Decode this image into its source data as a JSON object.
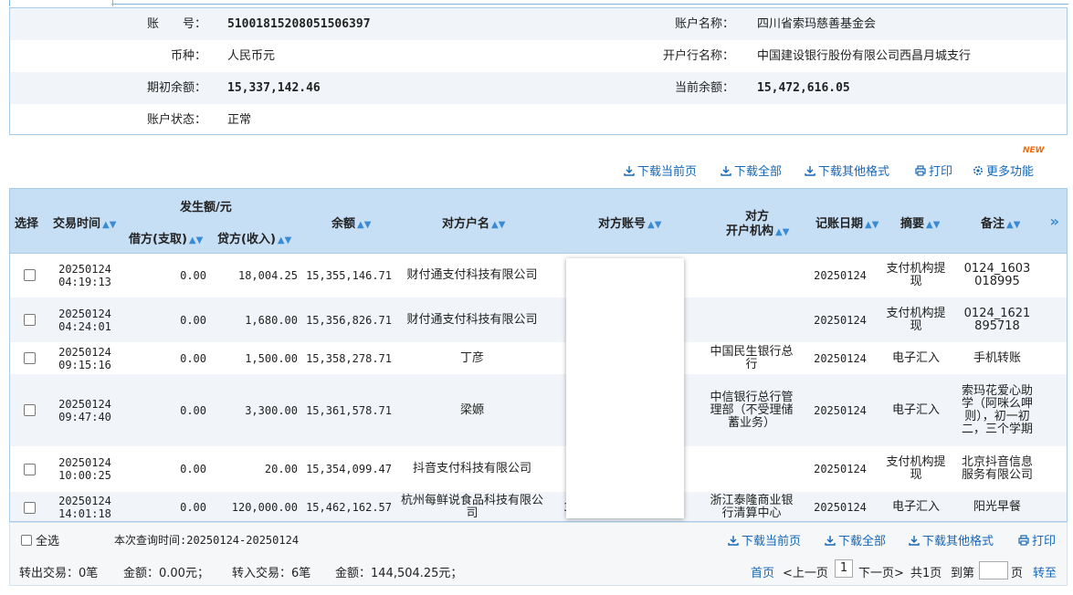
{
  "account_info": {
    "account_no_label": "账　　号：",
    "account_no": "51001815208051506397",
    "account_name_label": "账户名称：",
    "account_name": "四川省索玛慈善基金会",
    "currency_label": "币种：",
    "currency": "人民币元",
    "bank_label": "开户行名称：",
    "bank": "中国建设银行股份有限公司西昌月城支行",
    "opening_balance_label": "期初余额：",
    "opening_balance": "15,337,142.46",
    "current_balance_label": "当前余额：",
    "current_balance": "15,472,616.05",
    "status_label": "账户状态：",
    "status": "正常"
  },
  "toolbar": {
    "download_page": "下载当前页",
    "download_all": "下载全部",
    "download_other": "下载其他格式",
    "print": "打印",
    "more": "更多功能",
    "new_badge": "NEW"
  },
  "table": {
    "headers": {
      "select": "选择",
      "time": "交易时间",
      "amount_group": "发生额/元",
      "debit": "借方(支取)",
      "credit": "贷方(收入)",
      "balance": "余额",
      "counterparty_name": "对方户名",
      "counterparty_account": "对方账号",
      "counterparty_bank_1": "对方",
      "counterparty_bank_2": "开户机构",
      "post_date": "记账日期",
      "summary": "摘要",
      "remark": "备注",
      "more": "»"
    },
    "rows": [
      {
        "date": "20250124",
        "time": "04:19:13",
        "debit": "0.00",
        "credit": "18,004.25",
        "balance": "15,355,146.71",
        "name": "财付通支付科技有限公司",
        "bank": "",
        "post": "20250124",
        "summary": "支付机构提现",
        "remark": "0124_1603018995"
      },
      {
        "date": "20250124",
        "time": "04:24:01",
        "debit": "0.00",
        "credit": "1,680.00",
        "balance": "15,356,826.71",
        "name": "财付通支付科技有限公司",
        "bank": "",
        "post": "20250124",
        "summary": "支付机构提现",
        "remark": "0124_1621895718"
      },
      {
        "date": "20250124",
        "time": "09:15:16",
        "debit": "0.00",
        "credit": "1,500.00",
        "balance": "15,358,278.71",
        "name": "丁彦",
        "bank": "中国民生银行总行",
        "post": "20250124",
        "summary": "电子汇入",
        "remark": "手机转账"
      },
      {
        "date": "20250124",
        "time": "09:47:40",
        "debit": "0.00",
        "credit": "3,300.00",
        "balance": "15,361,578.71",
        "name": "梁嫄",
        "bank": "中信银行总行管理部（不受理储蓄业务）",
        "post": "20250124",
        "summary": "电子汇入",
        "remark": "索玛花爱心助学（阿咪么呷则），初一初二，三个学期"
      },
      {
        "date": "20250124",
        "time": "10:00:25",
        "debit": "0.00",
        "credit": "20.00",
        "balance": "15,354,099.47",
        "name": "抖音支付科技有限公司",
        "bank": "",
        "post": "20250124",
        "summary": "支付机构提现",
        "remark": "北京抖音信息服务有限公司"
      },
      {
        "date": "20250124",
        "time": "14:01:18",
        "debit": "0.00",
        "credit": "120,000.00",
        "balance": "15,462,162.57",
        "name": "杭州每鲜说食品科技有限公司",
        "account_partial": "3",
        "bank": "浙江泰隆商业银行清算中心",
        "post": "20250124",
        "summary": "电子汇入",
        "remark": "阳光早餐"
      }
    ]
  },
  "footer": {
    "select_all": "全选",
    "query_time": "本次查询时间:20250124-20250124",
    "download_page": "下载当前页",
    "download_all": "下载全部",
    "download_other": "下载其他格式",
    "print": "打印",
    "out_count": "转出交易：0笔",
    "out_amount": "金额：0.00元；",
    "in_count": "转入交易：6笔",
    "in_amount": "金额：144,504.25元；",
    "first_page": "首页",
    "prev_page": "<上一页",
    "current_page": "1",
    "next_page": "下一页>",
    "total_pages": "共1页",
    "goto_label": "到第",
    "page_unit": "页",
    "goto_button": "转至"
  },
  "colors": {
    "header_bg": "#c6dff5",
    "link": "#1767b6",
    "border": "#a9cbe6"
  }
}
